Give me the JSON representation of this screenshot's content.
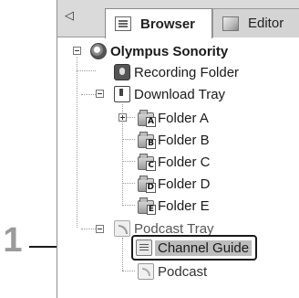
{
  "callout": {
    "number": "1"
  },
  "tabs": {
    "scroll_arrow": "◁",
    "browser": "Browser",
    "editor": "Editor"
  },
  "tree": {
    "root": "Olympus Sonority",
    "recording_folder": "Recording Folder",
    "download_tray": "Download Tray",
    "folders": [
      {
        "label": "Folder A",
        "badge": "A"
      },
      {
        "label": "Folder B",
        "badge": "B"
      },
      {
        "label": "Folder C",
        "badge": "C"
      },
      {
        "label": "Folder D",
        "badge": "D"
      },
      {
        "label": "Folder E",
        "badge": "E"
      }
    ],
    "podcast_tray": "Podcast Tray",
    "channel_guide": "Channel Guide",
    "podcast": "Podcast"
  }
}
